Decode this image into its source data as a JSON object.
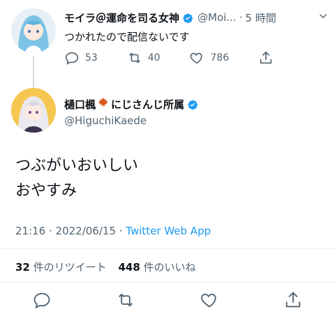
{
  "parent": {
    "name": "モイラ＠運命を司る女神",
    "handle": "@Moi...",
    "sep": "·",
    "time": "5 時間",
    "text": "つかれたので配信ないです",
    "replies": "53",
    "retweets": "40",
    "likes": "786"
  },
  "tweet": {
    "name_before_leaf": "樋口楓",
    "name_after_leaf": "にじさんじ所属",
    "handle": "@HiguchiKaede",
    "line1": "つぶがいおいしい",
    "line2": "おやすみ",
    "timestamp": "21:16 · 2022/06/15 · ",
    "client": "Twitter Web App",
    "retweet_count": "32",
    "retweet_label": "件のリツイート",
    "like_count": "448",
    "like_label": "件のいいね"
  },
  "colors": {
    "accent": "#1d9bf0",
    "muted": "#536471",
    "text": "#0f1419"
  }
}
